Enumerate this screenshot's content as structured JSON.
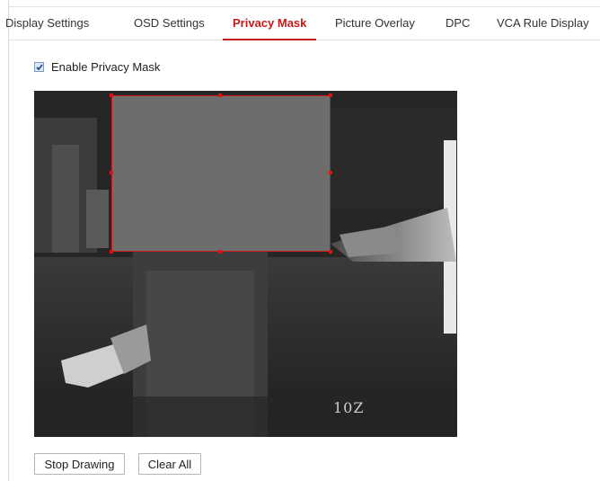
{
  "tabs": [
    {
      "label": "Display Settings",
      "active": false
    },
    {
      "label": "OSD Settings",
      "active": false
    },
    {
      "label": "Privacy Mask",
      "active": true
    },
    {
      "label": "Picture Overlay",
      "active": false
    },
    {
      "label": "DPC",
      "active": false
    },
    {
      "label": "VCA Rule Display",
      "active": false
    }
  ],
  "privacy": {
    "enable_label": "Enable Privacy Mask",
    "enabled": true
  },
  "video": {
    "osd_text": "10Z"
  },
  "buttons": {
    "stop_drawing": "Stop Drawing",
    "clear_all": "Clear All"
  },
  "colors": {
    "accent": "#c41a1a",
    "mask_fill": "#6d6d6d",
    "mask_border": "#d21a1a"
  }
}
